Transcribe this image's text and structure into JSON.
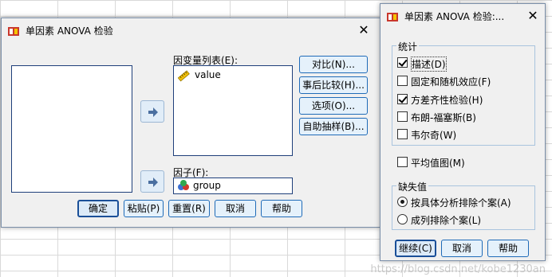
{
  "main_dialog": {
    "title": "单因素 ANOVA 检验",
    "close": "✕",
    "dependent_list_label": "因变量列表(E):",
    "dependent_items": [
      {
        "name": "value",
        "icon": "ruler-icon"
      }
    ],
    "factor_label": "因子(F):",
    "factor_value": "group",
    "side_buttons": [
      "对比(N)...",
      "事后比较(H)...",
      "选项(O)...",
      "自助抽样(B)..."
    ],
    "bottom_buttons": [
      "确定",
      "粘贴(P)",
      "重置(R)",
      "取消",
      "帮助"
    ]
  },
  "options_dialog": {
    "title": "单因素 ANOVA 检验:...",
    "close": "✕",
    "stats_group_title": "统计",
    "stats_options": [
      {
        "label": "描述(D)",
        "checked": true
      },
      {
        "label": "固定和随机效应(F)",
        "checked": false
      },
      {
        "label": "方差齐性检验(H)",
        "checked": true
      },
      {
        "label": "布朗-福塞斯(B)",
        "checked": false
      },
      {
        "label": "韦尔奇(W)",
        "checked": false
      }
    ],
    "means_plot": {
      "label": "平均值图(M)",
      "checked": false
    },
    "missing_group_title": "缺失值",
    "missing_options": [
      {
        "label": "按具体分析排除个案(A)",
        "selected": true
      },
      {
        "label": "成列排除个案(L)",
        "selected": false
      }
    ],
    "buttons": [
      "继续(C)",
      "取消",
      "帮助"
    ]
  },
  "watermark": "https://blog.csdn.net/kobe1230an"
}
